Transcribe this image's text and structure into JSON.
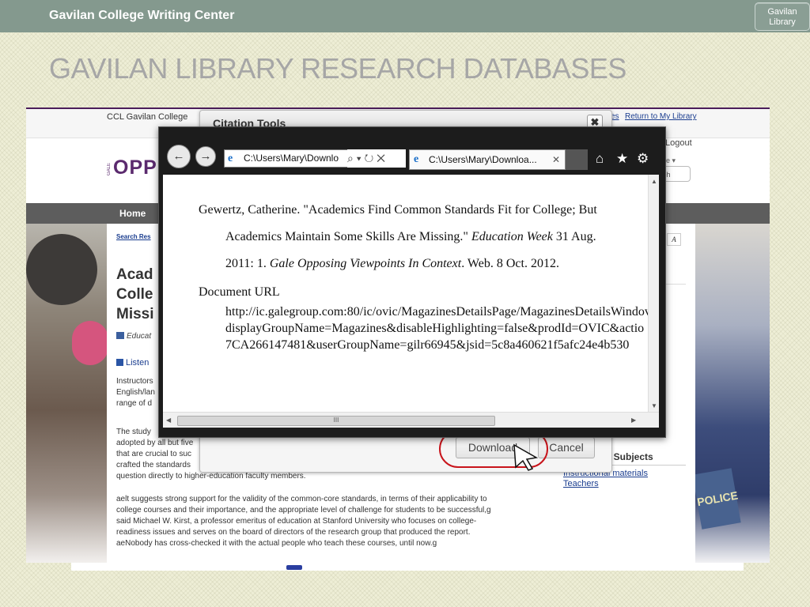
{
  "slide": {
    "header_title": "Gavilan College Writing Center",
    "library_button": [
      "Gavilan",
      "Library"
    ],
    "title": "GAVILAN LIBRARY RESEARCH DATABASES"
  },
  "webpage": {
    "ccl_label": "CCL Gavilan College",
    "link_fragment": "es",
    "return_link": "Return to My Library",
    "logout": "Logout",
    "more": "re ▾",
    "search": "ch",
    "logo": "OPP",
    "gale": "GALE",
    "nav_home": "Home",
    "breadcrumb": "Search Res",
    "article_title_lines": [
      "Acad",
      "Colle",
      "Missi"
    ],
    "source_fragment": "Educat",
    "listen": "Listen",
    "text_size_button": "A",
    "para1": [
      "Instructors",
      "English/lan",
      "range of d"
    ],
    "para2": [
      "The study",
      "adopted by all but five",
      "that are crucial to suc",
      "crafted the standards",
      "question directly to higher-education faculty members."
    ],
    "para3": [
      "aelt suggests strong support for the validity of the common-core standards, in terms of their applicability to",
      "college courses and their importance, and the appropriate level of challenge for students to be successful,g",
      "said Michael W. Kirst, a professor emeritus of education at Stanford University who focuses on college-",
      "readiness issues and serves on the board of directors of the research group that produced the report.",
      "aeNobody has cross-checked it with the actual people who teach these courses, until now.g"
    ],
    "related_heading": "d Subjects",
    "related_links": [
      "Instructional materials",
      "Teachers"
    ]
  },
  "dialog": {
    "title": "Citation Tools",
    "close": "✖",
    "download": "Download",
    "cancel": "Cancel"
  },
  "browser": {
    "back": "←",
    "forward": "→",
    "address": "C:\\Users\\Mary\\Downlo",
    "address_controls": "⌕ ▾ ↻ ✕",
    "tab_label": "C:\\Users\\Mary\\Downloa...",
    "tab_close": "✕",
    "home": "⌂",
    "favorites": "★",
    "settings": "⚙",
    "citation": {
      "line1": "Gewertz, Catherine. \"Academics Find Common Standards Fit for College; But",
      "line2a": "Academics Maintain Some Skills Are Missing.\" ",
      "line2b": "Education Week",
      "line2c": " 31 Aug.",
      "line3a": "2011: 1. ",
      "line3b": "Gale Opposing Viewpoints In Context",
      "line3c": ". Web. 8 Oct. 2012."
    },
    "url_label": "Document URL",
    "url_lines": [
      "http://ic.galegroup.com:80/ic/ovic/MagazinesDetailsPage/MagazinesDetailsWindov",
      "displayGroupName=Magazines&disableHighlighting=false&prodId=OVIC&actio",
      "7CA266147481&userGroupName=gilr66945&jsid=5c8a460621f5afc24e4b530"
    ],
    "scroll_grip": "III"
  },
  "colors": {
    "topbar": "#84998e",
    "title": "#a6a6a6",
    "highlight_ring": "#c8141b",
    "logo": "#5b2a6e"
  }
}
